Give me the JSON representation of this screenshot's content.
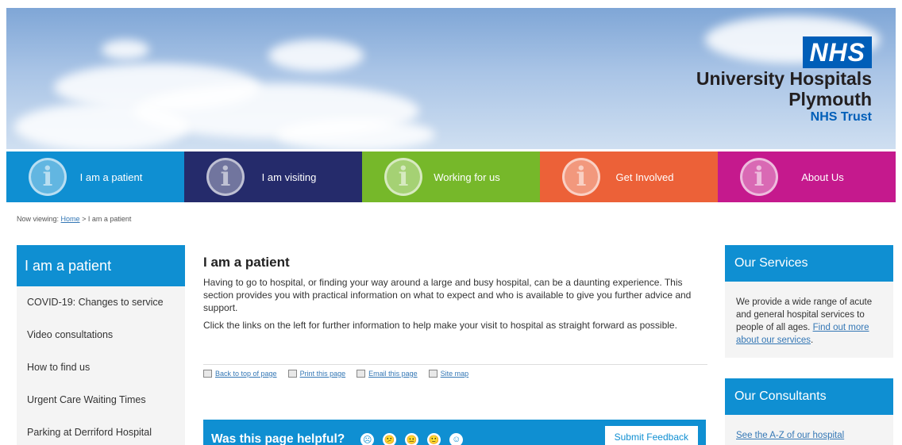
{
  "header": {
    "logo_badge": "NHS",
    "logo_line1": "University Hospitals",
    "logo_line2": "Plymouth",
    "logo_line3": "NHS Trust"
  },
  "nav": {
    "items": [
      {
        "label": "I am a patient",
        "color": "#0f8fd2",
        "icon": "info-icon"
      },
      {
        "label": "I am visiting",
        "color": "#252b6b",
        "icon": "info-icon"
      },
      {
        "label": "Working for us",
        "color": "#76b82a",
        "icon": "info-icon"
      },
      {
        "label": "Get Involved",
        "color": "#ec6138",
        "icon": "info-icon"
      },
      {
        "label": "About Us",
        "color": "#c5198d",
        "icon": "info-icon"
      }
    ]
  },
  "breadcrumb": {
    "prefix": "Now viewing:",
    "home": "Home",
    "separator": ">",
    "current": "I am a patient"
  },
  "left_sidebar": {
    "title": "I am a patient",
    "items": [
      "COVID-19: Changes to service",
      "Video consultations",
      "How to find us",
      "Urgent Care Waiting Times",
      "Parking at Derriford Hospital"
    ]
  },
  "main": {
    "title": "I am a patient",
    "para1": "Having to go to hospital, or finding your way around a large and busy hospital, can be a daunting experience. This section provides you with practical information on what to expect and who is available to give you further advice and support.",
    "para2": "Click the links on the left for further information to help make your visit to hospital as straight forward as possible.",
    "tools": [
      "Back to top of page",
      "Print this page",
      "Email this page",
      "Site map"
    ],
    "feedback_question": "Was this page helpful?",
    "feedback_submit": "Submit Feedback",
    "smileys": [
      "☹",
      "😕",
      "😐",
      "🙂",
      "☺"
    ]
  },
  "right_sidebar": {
    "services_title": "Our Services",
    "services_text": "We provide a wide range of acute and general hospital services to people of all ages.",
    "services_link": "Find out more about our services",
    "consultants_title": "Our Consultants",
    "consultants_text": "See the A-Z of our hospital"
  }
}
